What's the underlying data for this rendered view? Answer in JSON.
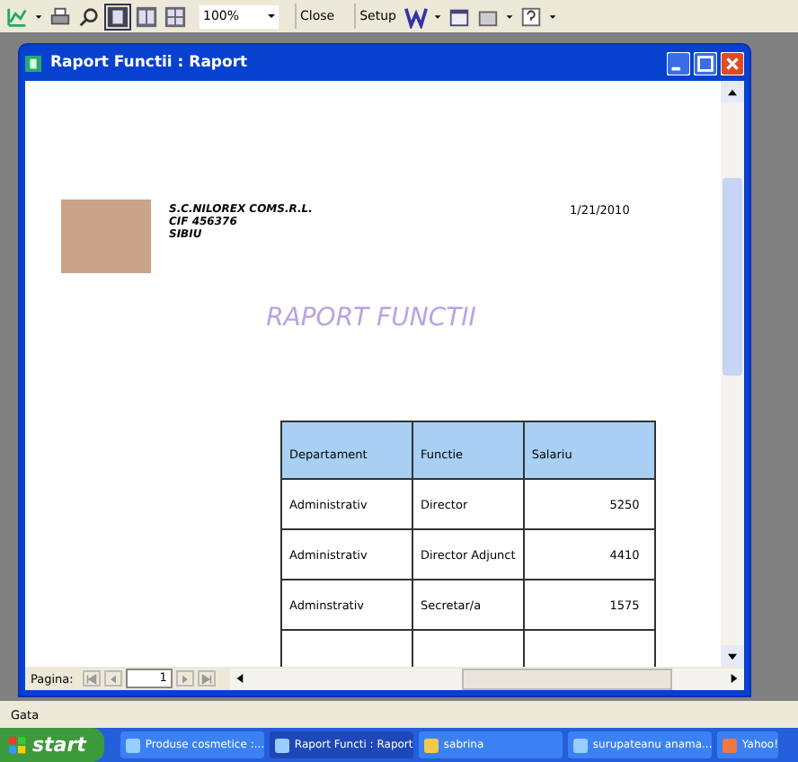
{
  "toolbar": {
    "zoom": "100%",
    "buttons": [
      "Close",
      "Setup"
    ]
  },
  "window": {
    "title": "Raport Functii : Raport"
  },
  "report": {
    "company_lines": [
      "S.C.NILOREX COMS.R.L.",
      "CIF 456376",
      "SIBIU"
    ],
    "date": "1/21/2010",
    "title": "RAPORT FUNCTII",
    "table": {
      "columns": [
        "Departament",
        "Functie",
        "Salariu"
      ],
      "rows": [
        [
          "Administrativ",
          "Director",
          "5250"
        ],
        [
          "Administrativ",
          "Director Adjunct",
          "4410"
        ],
        [
          "Adminstrativ",
          "Secretar/a",
          "1575"
        ]
      ]
    }
  },
  "pager": {
    "label": "Pagina:",
    "page": "1"
  },
  "status_bar": "Gata",
  "taskbar": {
    "start": "start",
    "items": [
      {
        "label": "Produse cosmetice :...",
        "selected": false
      },
      {
        "label": "Raport Functi : Raport",
        "selected": true
      },
      {
        "label": "sabrina",
        "selected": false
      },
      {
        "label": "surupateanu anama...",
        "selected": false
      },
      {
        "label": "Yahoo!",
        "selected": false
      }
    ]
  }
}
